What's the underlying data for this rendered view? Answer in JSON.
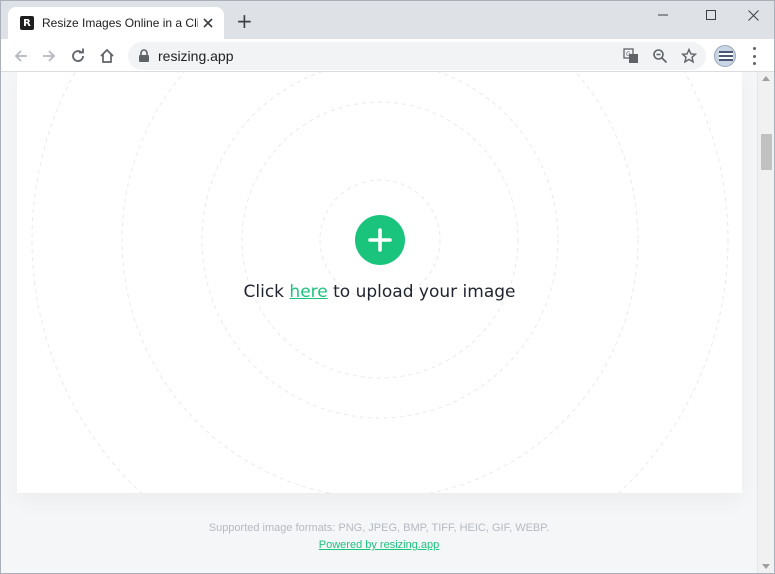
{
  "browser": {
    "tab": {
      "favicon_letter": "R",
      "title": "Resize Images Online in a Click"
    },
    "address_bar": {
      "url": "resizing.app"
    },
    "icons": {
      "back": "arrow-left-icon",
      "forward": "arrow-right-icon",
      "reload": "reload-icon",
      "home": "home-icon",
      "lock": "lock-icon",
      "translate": "translate-icon",
      "zoom": "zoom-icon",
      "bookmark": "star-icon",
      "menu": "kebab-menu-icon"
    }
  },
  "page": {
    "upload": {
      "prefix": "Click",
      "link": "here",
      "suffix": "to upload your image"
    },
    "footer": {
      "formats": "Supported image formats: PNG, JPEG, BMP, TIFF, HEIC, GIF, WEBP.",
      "powered_by": "Powered by resizing.app"
    }
  },
  "colors": {
    "accent": "#1bc47d",
    "text": "#1f2430",
    "muted": "#b5b9c0"
  }
}
